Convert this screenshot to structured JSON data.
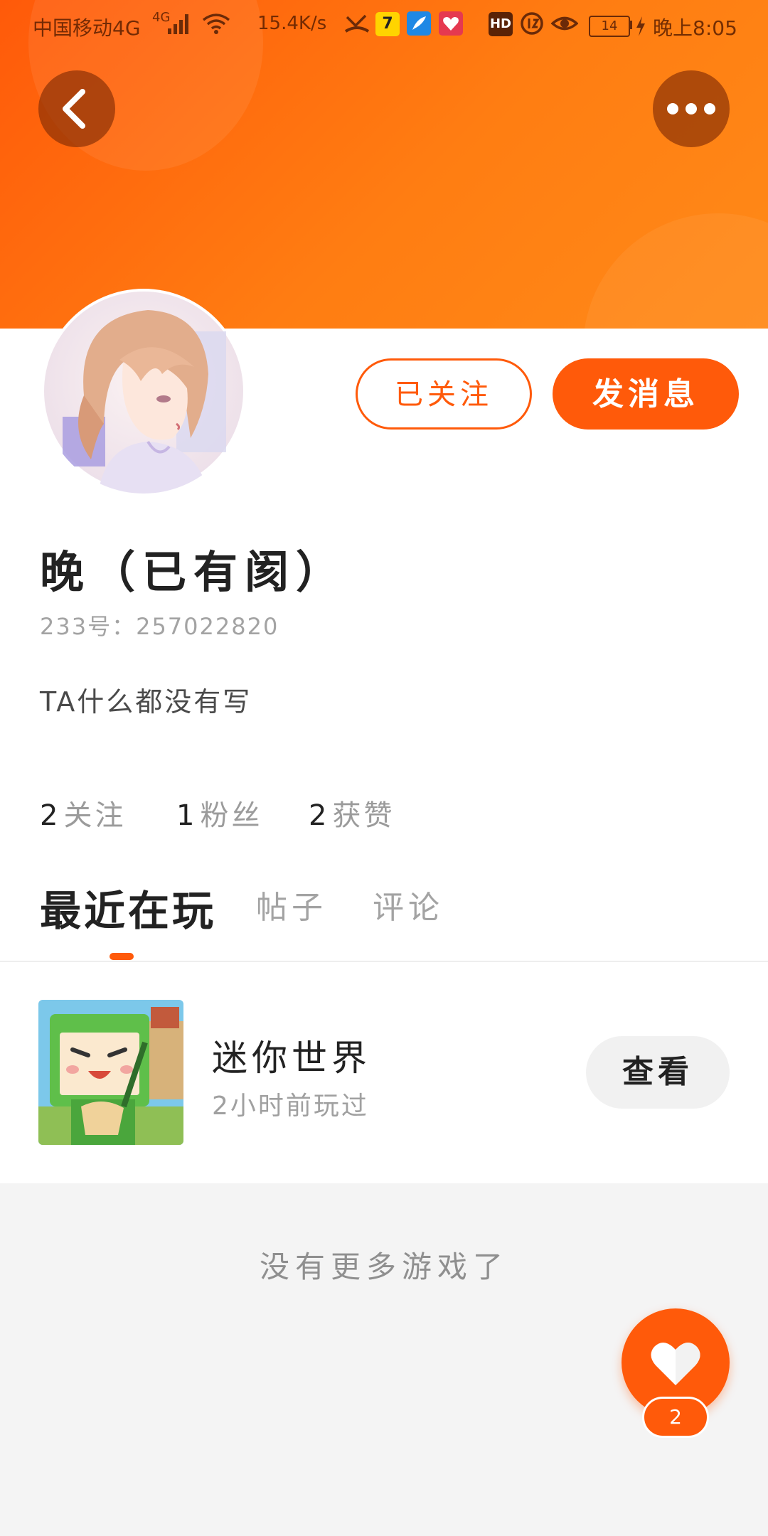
{
  "status_bar": {
    "carrier": "中国移动4G",
    "network_badge": "4G",
    "speed": "15.4K/s",
    "battery": "14",
    "time": "晚上8:05",
    "hd_badge": "HD",
    "app_badge_qq": "7"
  },
  "header": {
    "back_icon": "chevron-left-icon",
    "more_icon": "more-horizontal-icon"
  },
  "profile": {
    "follow_button": "已关注",
    "message_button": "发消息",
    "username": "晚（已有阂）",
    "uid": "233号：257022820",
    "bio": "TA什么都没有写",
    "stats": [
      {
        "num": "2",
        "label": "关注"
      },
      {
        "num": "1",
        "label": "粉丝"
      },
      {
        "num": "2",
        "label": "获赞"
      }
    ]
  },
  "tabs": [
    {
      "label": "最近在玩",
      "active": true
    },
    {
      "label": "帖子",
      "active": false
    },
    {
      "label": "评论",
      "active": false
    }
  ],
  "games": [
    {
      "title": "迷你世界",
      "subtitle": "2小时前玩过",
      "action": "查看"
    }
  ],
  "empty_message": "没有更多游戏了",
  "like_fab": {
    "icon": "heart-icon",
    "count": "2"
  },
  "colors": {
    "accent": "#ff5a0a",
    "header_gradient_end": "#ff8a18",
    "text_primary": "#222222",
    "text_secondary": "#a3a3a3",
    "page_background": "#f4f4f4"
  }
}
